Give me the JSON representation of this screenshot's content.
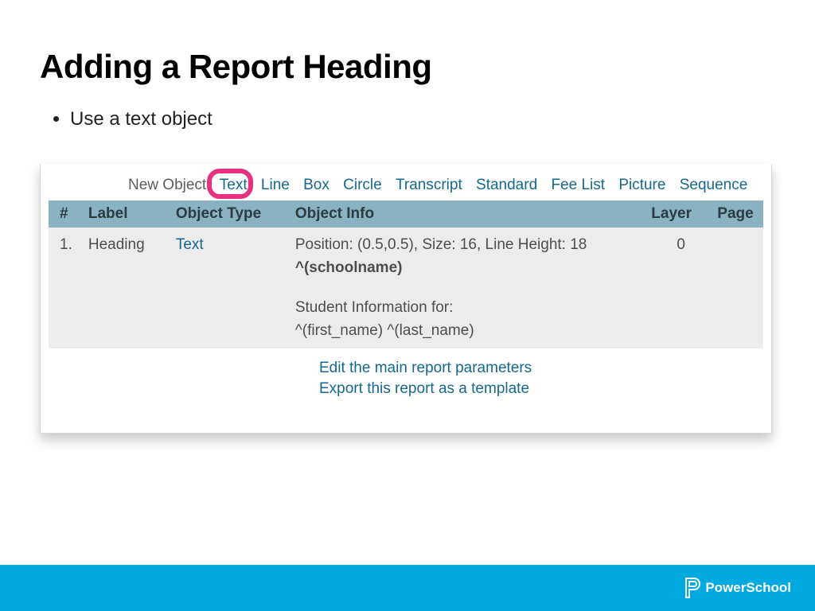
{
  "slide": {
    "title": "Adding a Report Heading",
    "bullet": "Use a text object"
  },
  "new_object": {
    "label": "New Object:",
    "links": [
      "Text",
      "Line",
      "Box",
      "Circle",
      "Transcript",
      "Standard",
      "Fee List",
      "Picture",
      "Sequence"
    ]
  },
  "table": {
    "headers": {
      "num": "#",
      "label": "Label",
      "type": "Object Type",
      "info": "Object Info",
      "layer": "Layer",
      "page": "Page"
    },
    "rows": [
      {
        "num": "1.",
        "label": "Heading",
        "type": "Text",
        "info_line1": "Position: (0.5,0.5), Size: 16, Line Height: 18",
        "info_line2": "^(schoolname)",
        "info_line3": "Student Information for:",
        "info_line4": "^(first_name) ^(last_name)",
        "layer": "0",
        "page": ""
      }
    ]
  },
  "actions": {
    "edit": "Edit the main report parameters",
    "export": "Export this report as a template"
  },
  "footer": {
    "brand": "PowerSchool"
  }
}
